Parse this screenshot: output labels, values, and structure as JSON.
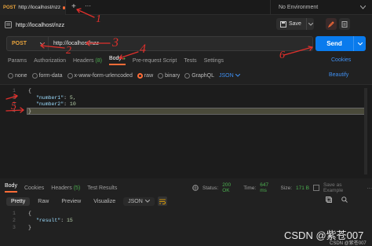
{
  "top_tab": {
    "method": "POST",
    "url": "http://localhost/nzz",
    "plus": "+",
    "more": "···"
  },
  "environment": {
    "label": "No Environment"
  },
  "request": {
    "title": "http://localhost/nzz",
    "save_label": "Save",
    "method": "POST",
    "url": "http://localhost/nzz",
    "send_label": "Send"
  },
  "req_tabs": [
    {
      "label": "Params"
    },
    {
      "label": "Authorization"
    },
    {
      "label": "Headers",
      "count": "(8)"
    },
    {
      "label": "Body",
      "badge": "●"
    },
    {
      "label": "Pre-request Script"
    },
    {
      "label": "Tests"
    },
    {
      "label": "Settings"
    }
  ],
  "cookies_label": "Cookies",
  "body_options": [
    "none",
    "form-data",
    "x-www-form-urlencoded",
    "raw",
    "binary",
    "GraphQL"
  ],
  "body_format": "JSON",
  "beautify_label": "Beautify",
  "editor": {
    "lines": [
      "1",
      "2",
      "3",
      "4"
    ],
    "open": "{",
    "k1": "\"number1\"",
    "v1": "5,",
    "k2": "\"number2\"",
    "v2": "10",
    "close": "}"
  },
  "resp_tabs": [
    {
      "label": "Body"
    },
    {
      "label": "Cookies"
    },
    {
      "label": "Headers",
      "count": "(5)"
    },
    {
      "label": "Test Results"
    }
  ],
  "resp_meta": {
    "status_label": "Status:",
    "status_value": "200 OK",
    "time_label": "Time:",
    "time_value": "647 ms",
    "size_label": "Size:",
    "size_value": "171 B",
    "save_example": "Save as Example",
    "more": "···"
  },
  "resp_view": [
    "Pretty",
    "Raw",
    "Preview",
    "Visualize"
  ],
  "resp_format": "JSON",
  "response": {
    "lines": [
      "1",
      "2",
      "3"
    ],
    "open": "{",
    "key": "\"result\"",
    "value": "15",
    "close": "}"
  },
  "watermark": {
    "main": "CSDN @紫苍007",
    "small": "CSDN @紫苍007"
  },
  "annotations": [
    "1",
    "2",
    "3",
    "4",
    "5",
    "6"
  ],
  "colors": {
    "accent": "#ff6c37",
    "send": "#097bed",
    "link": "#3f8ff0",
    "annotation": "#e0302c"
  }
}
